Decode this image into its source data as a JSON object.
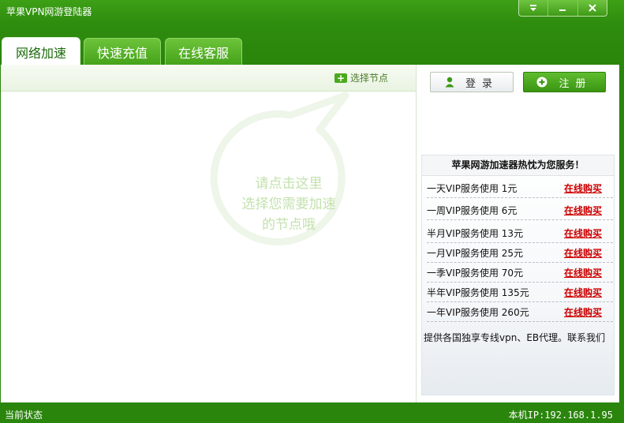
{
  "window": {
    "title": "苹果VPN网游登陆器"
  },
  "controls": {
    "menu_icon": "menu-down-icon",
    "min_icon": "minimize-icon",
    "close_icon": "close-icon"
  },
  "tabs": [
    {
      "label": "网络加速",
      "active": true
    },
    {
      "label": "快速充值",
      "active": false
    },
    {
      "label": "在线客服",
      "active": false
    }
  ],
  "node_bar": {
    "label": "选择节点"
  },
  "hint": {
    "lines": [
      "请点击这里",
      "选择您需要加速",
      "的节点哦"
    ]
  },
  "buttons": {
    "login": "登录",
    "register": "注册"
  },
  "service_panel": {
    "title": "苹果网游加速器热忱为您服务！",
    "rows": [
      {
        "text": "一天VIP服务使用  1元",
        "link": "在线购买"
      },
      {
        "text": "一周VIP服务使用  6元",
        "link": "在线购买"
      },
      {
        "text": "半月VIP服务使用  13元",
        "link": "在线购买"
      },
      {
        "text": "一月VIP服务使用  25元",
        "link": "在线购买"
      },
      {
        "text": "一季VIP服务使用  70元",
        "link": "在线购买"
      },
      {
        "text": "半年VIP服务使用  135元",
        "link": "在线购买"
      },
      {
        "text": "一年VIP服务使用  260元",
        "link": "在线购买"
      }
    ],
    "footer": "提供各国独享专线vpn、EB代理。联系我们"
  },
  "status": {
    "left": "当前状态",
    "right": "本机IP:192.168.1.95"
  },
  "colors": {
    "accent": "#3a9a14",
    "link": "#cc0000",
    "hint": "#c3e1ad"
  }
}
